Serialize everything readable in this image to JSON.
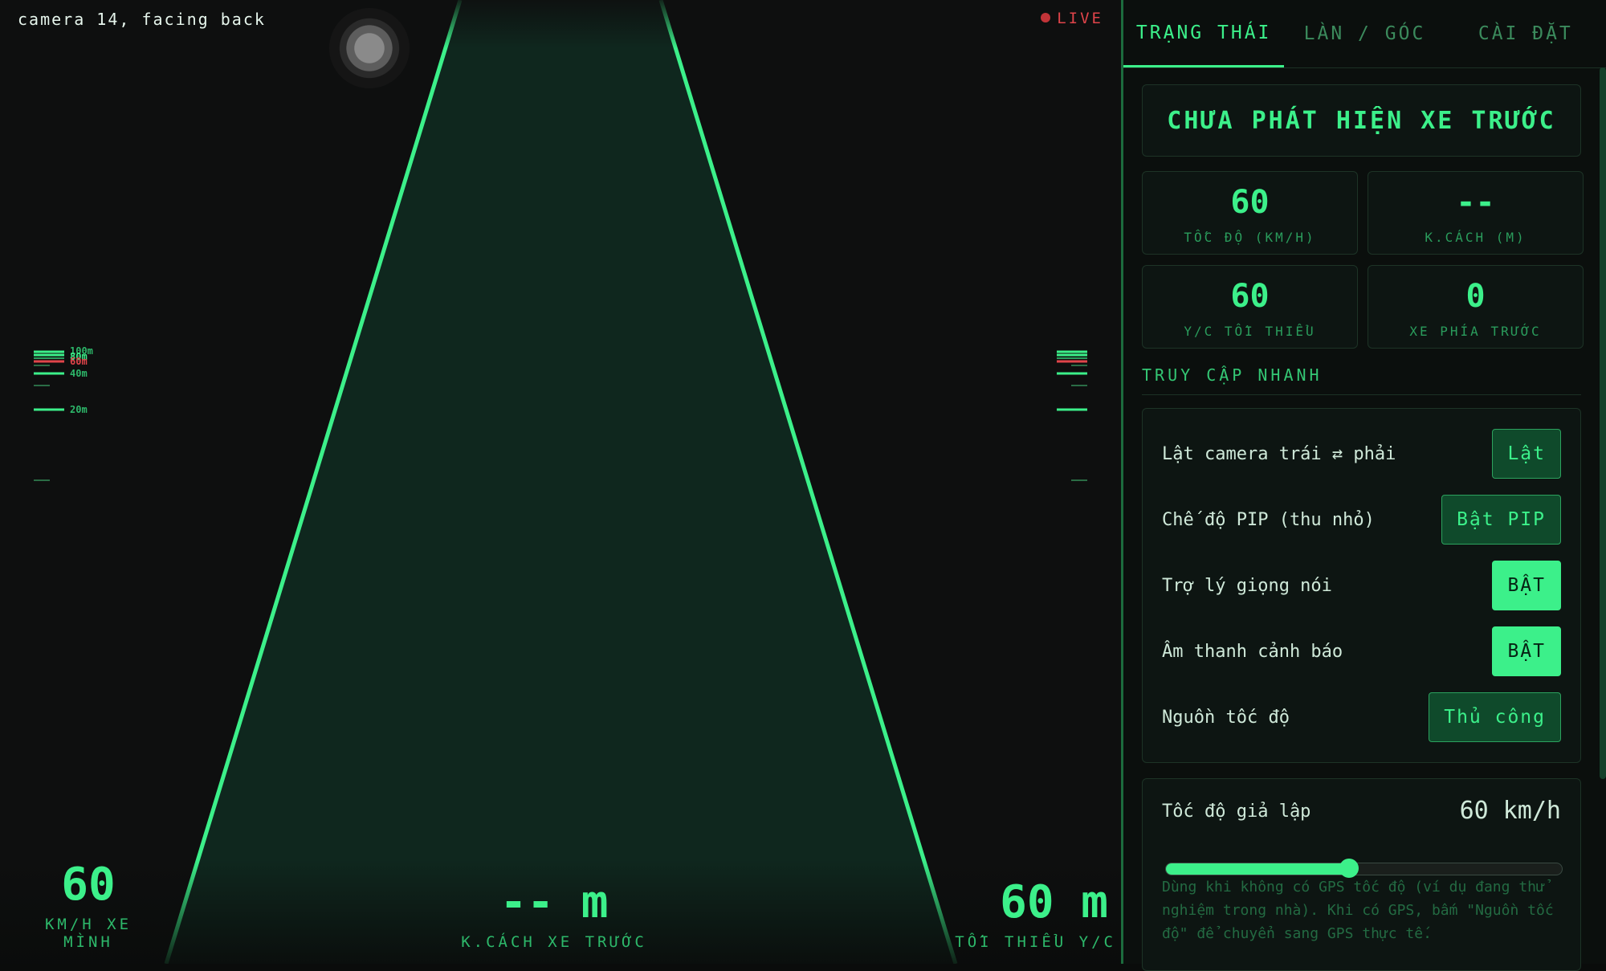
{
  "camera": {
    "label": "camera 14, facing back",
    "live_label": "LIVE",
    "distance_scale": [
      "100m",
      "80m",
      "60m",
      "40m",
      "20m"
    ],
    "bottom": {
      "speed": {
        "value": "60",
        "label": "KM/H XE MÌNH"
      },
      "distance": {
        "value": "-- m",
        "label": "K.CÁCH XE TRƯỚC"
      },
      "min_gap": {
        "value": "60 m",
        "label": "TỐI THIỂU Y/C"
      }
    }
  },
  "tabs": [
    "TRẠNG THÁI",
    "LÀN / GÓC",
    "CÀI ĐẶT"
  ],
  "active_tab": 0,
  "status": {
    "alert": "CHƯA PHÁT HIỆN XE TRƯỚC",
    "stats": [
      {
        "value": "60",
        "label": "TỐC ĐỘ (KM/H)"
      },
      {
        "value": "--",
        "label": "K.CÁCH (M)"
      },
      {
        "value": "60",
        "label": "Y/C TỐI THIỂU"
      },
      {
        "value": "0",
        "label": "XE PHÍA TRƯỚC"
      }
    ]
  },
  "quick_access": {
    "title": "TRUY CẬP NHANH",
    "rows": [
      {
        "label": "Lật camera trái ⇄ phải",
        "button": "Lật",
        "on": false
      },
      {
        "label": "Chế độ PIP (thu nhỏ)",
        "button": "Bật PIP",
        "on": false
      },
      {
        "label": "Trợ lý giọng nói",
        "button": "BẬT",
        "on": true
      },
      {
        "label": "Âm thanh cảnh báo",
        "button": "BẬT",
        "on": true
      },
      {
        "label": "Nguồn tốc độ",
        "button": "Thủ công",
        "on": false
      }
    ]
  },
  "simulated_speed": {
    "label": "Tốc độ giả lập",
    "value_text": "60 km/h",
    "value": 60,
    "min": 0,
    "max": 130,
    "hint": "Dùng khi không có GPS tốc độ (ví dụ đang thử nghiệm trong nhà). Khi có GPS, bấm \"Nguồn tốc độ\" để chuyển sang GPS thực tế."
  },
  "colors": {
    "accent": "#3cf08a",
    "warning": "#e0444a",
    "panel_bg": "#0b0f0d"
  }
}
